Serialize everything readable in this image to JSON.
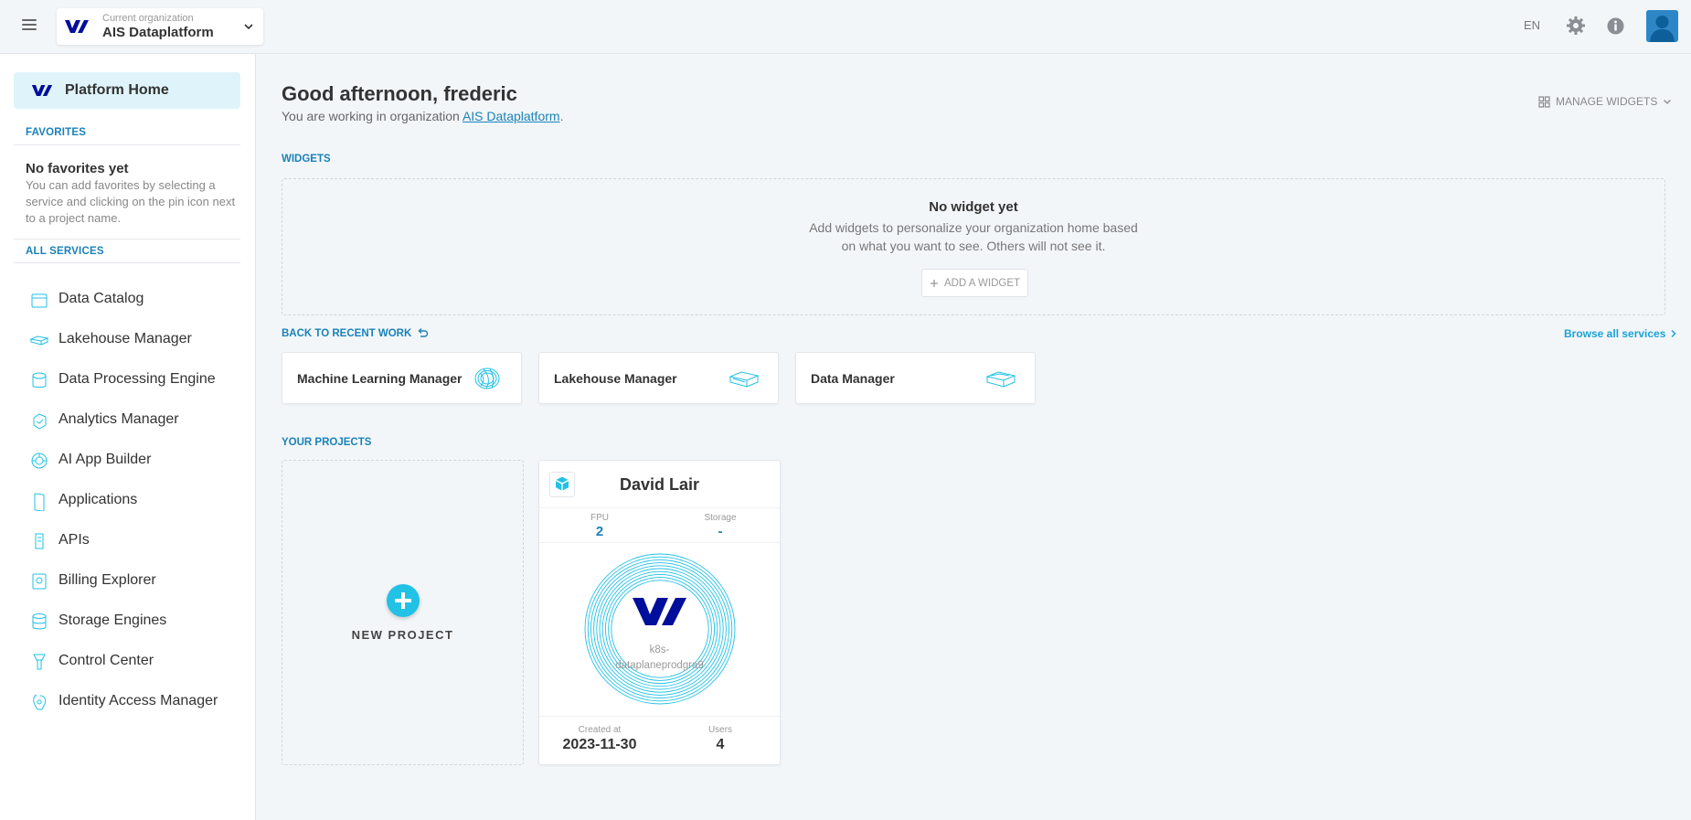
{
  "topbar": {
    "org_sublabel": "Current organization",
    "org_name": "AIS Dataplatform",
    "language": "EN"
  },
  "sidebar": {
    "home_label": "Platform Home",
    "favorites_heading": "FAVORITES",
    "favorites_empty_title": "No favorites yet",
    "favorites_empty_text": "You can add favorites by selecting a service and clicking on the pin icon next to a project name.",
    "services_heading": "ALL SERVICES",
    "services": [
      {
        "label": "Data Catalog",
        "icon": "data-catalog-icon"
      },
      {
        "label": "Lakehouse Manager",
        "icon": "lakehouse-manager-icon"
      },
      {
        "label": "Data Processing Engine",
        "icon": "data-processing-engine-icon"
      },
      {
        "label": "Analytics Manager",
        "icon": "analytics-manager-icon"
      },
      {
        "label": "AI App Builder",
        "icon": "ai-app-builder-icon"
      },
      {
        "label": "Applications",
        "icon": "applications-icon"
      },
      {
        "label": "APIs",
        "icon": "apis-icon"
      },
      {
        "label": "Billing Explorer",
        "icon": "billing-explorer-icon"
      },
      {
        "label": "Storage Engines",
        "icon": "storage-engines-icon"
      },
      {
        "label": "Control Center",
        "icon": "control-center-icon"
      },
      {
        "label": "Identity Access Manager",
        "icon": "identity-access-manager-icon"
      }
    ]
  },
  "main": {
    "greeting": "Good afternoon, frederic",
    "working_prefix": "You are working in organization ",
    "working_org": "AIS Dataplatform",
    "working_suffix": ".",
    "manage_widgets": "MANAGE WIDGETS",
    "widgets_heading": "WIDGETS",
    "no_widget_title": "No widget yet",
    "no_widget_text": "Add widgets to personalize your organization home based on what you want to see. Others will not see it.",
    "add_widget": "ADD A WIDGET",
    "recent_heading": "BACK TO RECENT WORK",
    "browse_all": "Browse all services",
    "recent": [
      {
        "label": "Machine Learning Manager",
        "icon": "machine-learning-manager-icon"
      },
      {
        "label": "Lakehouse Manager",
        "icon": "lakehouse-manager-icon"
      },
      {
        "label": "Data Manager",
        "icon": "data-manager-icon"
      }
    ],
    "projects_heading": "YOUR PROJECTS",
    "new_project": "NEW PROJECT",
    "project": {
      "name": "David Lair",
      "fpu_label": "FPU",
      "fpu_value": "2",
      "storage_label": "Storage",
      "storage_value": "-",
      "cluster_line1": "k8s-",
      "cluster_line2": "dataplaneprodgra9",
      "created_label": "Created at",
      "created_value": "2023-11-30",
      "users_label": "Users",
      "users_value": "4"
    }
  },
  "colors": {
    "accent": "#1a82b8",
    "accent_light": "#22c1e6",
    "brand_logo": "#000e9c",
    "highlight_bg": "#dff4fa"
  }
}
